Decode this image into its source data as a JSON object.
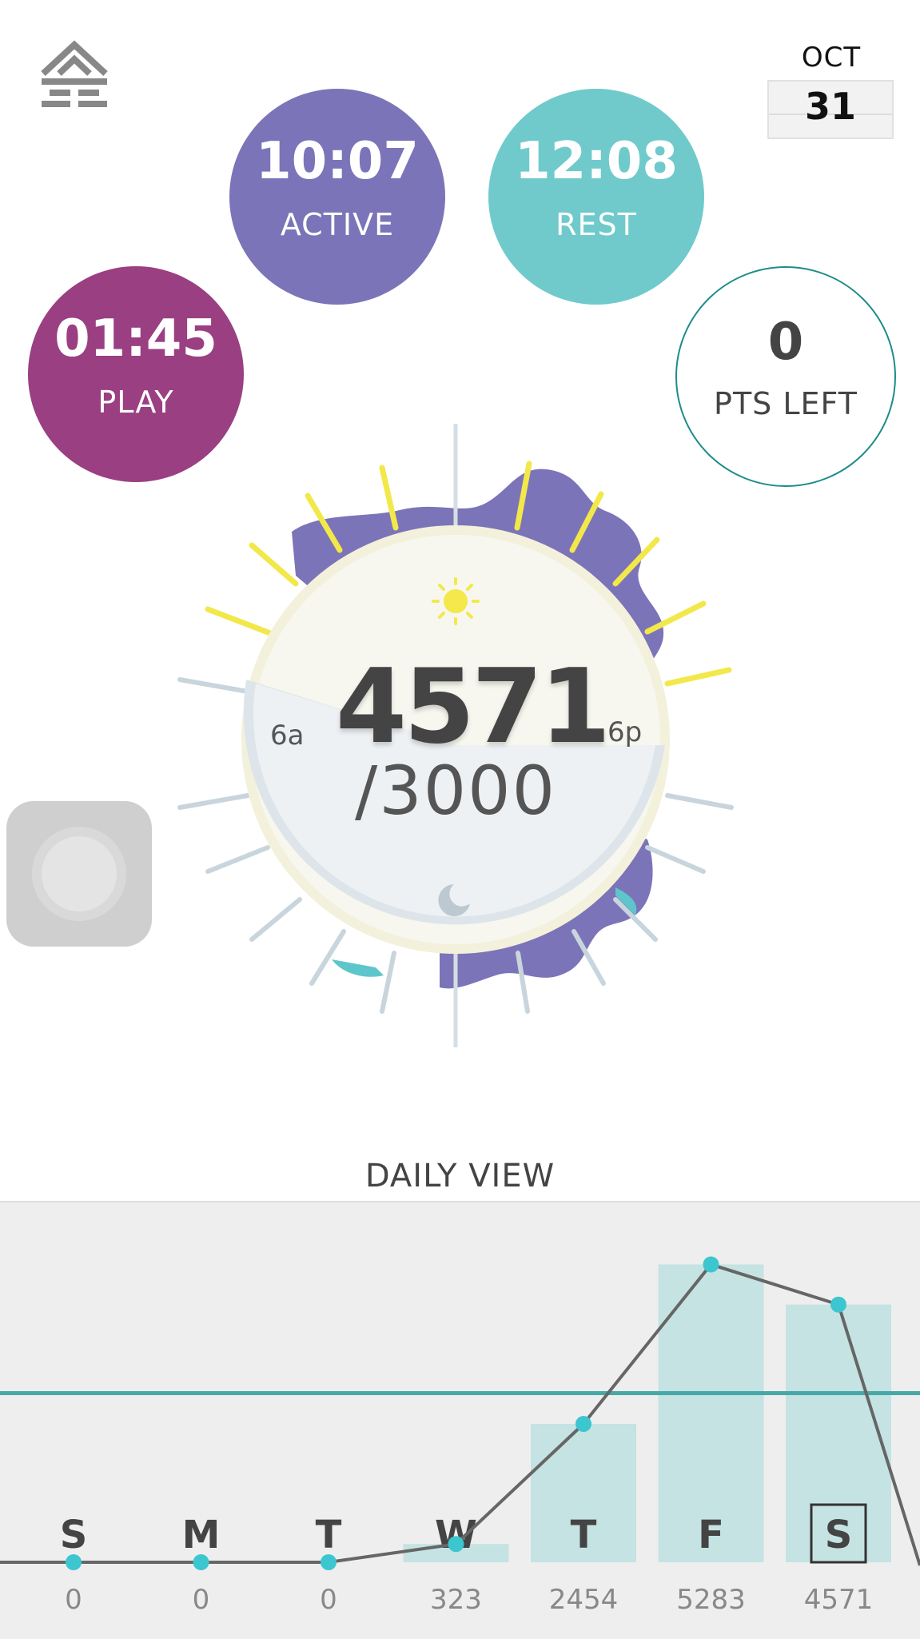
{
  "header": {
    "logo_icon": "home-app-logo-icon",
    "date": {
      "month": "OCT",
      "day": "31"
    }
  },
  "bubbles": {
    "active": {
      "time": "10:07",
      "label": "ACTIVE",
      "color": "#7c74b8"
    },
    "rest": {
      "time": "12:08",
      "label": "REST",
      "color": "#70cacb"
    },
    "play": {
      "time": "01:45",
      "label": "PLAY",
      "color": "#9a3f82"
    },
    "points": {
      "value": "0",
      "label": "PTS LEFT",
      "ring_color": "#1e8c8a"
    }
  },
  "dial": {
    "score": "4571",
    "goal": "/3000",
    "label_morning": "6a",
    "label_evening": "6p",
    "day_icon": "sun-icon",
    "night_icon": "moon-icon"
  },
  "assist_button_icon": "assistive-touch-icon",
  "daily_view": {
    "title": "DAILY VIEW",
    "chart_data": {
      "type": "bar",
      "categories": [
        "S",
        "M",
        "T",
        "W",
        "T",
        "F",
        "S"
      ],
      "values": [
        0,
        0,
        0,
        323,
        2454,
        5283,
        4571
      ],
      "value_labels": [
        "0",
        "0",
        "0",
        "323",
        "2454",
        "5283",
        "4571"
      ],
      "goal_line": 3000,
      "selected_index": 6,
      "ylim": [
        0,
        5900
      ],
      "line_overlay": true,
      "colors": {
        "bar": "#c5e3e2",
        "line": "#666666",
        "point": "#3cc6cf",
        "goal": "#47a9a6"
      }
    }
  }
}
